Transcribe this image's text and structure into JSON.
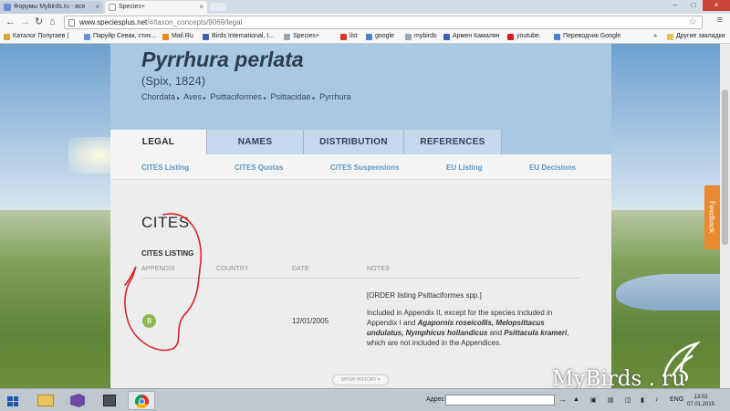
{
  "browser": {
    "tabs": [
      {
        "title": "Форумы Mybirds.ru - вся",
        "active": false
      },
      {
        "title": "Species+",
        "active": true
      }
    ],
    "url": {
      "host": "www.speciesplus.net",
      "path": "/#/taxon_concepts/9069/legal"
    },
    "bookmarks": [
      {
        "label": "Каталог Попугаев |",
        "color": "#d9a441"
      },
      {
        "label": "Паруйр Севак, стих...",
        "color": "#6a8ed6"
      },
      {
        "label": "Mail.Ru",
        "color": "#e98a1c"
      },
      {
        "label": "Birds International, I...",
        "color": "#3b64b0"
      },
      {
        "label": "Species+",
        "color": "#9aa5b1"
      },
      {
        "label": "list",
        "color": "#d23b2b"
      },
      {
        "label": "google",
        "color": "#4a7fd6"
      },
      {
        "label": "mybirds",
        "color": "#9aa5b1"
      },
      {
        "label": "Армен Камалян",
        "color": "#3b64b0"
      },
      {
        "label": "youtube.",
        "color": "#d21e1e"
      },
      {
        "label": "Переводчик Google",
        "color": "#4a7fd6"
      }
    ],
    "bookmarks_overflow": "»",
    "other_bookmarks": "Другие закладки"
  },
  "page": {
    "species_name": "Pyrrhura perlata",
    "author": "(Spix, 1824)",
    "taxonomy": [
      "Chordata",
      "Aves",
      "Psittaciformes",
      "Psittacidae",
      "Pyrrhura"
    ],
    "tabs": [
      {
        "label": "LEGAL",
        "active": true
      },
      {
        "label": "NAMES",
        "active": false
      },
      {
        "label": "DISTRIBUTION",
        "active": false
      },
      {
        "label": "REFERENCES",
        "active": false
      }
    ],
    "subtabs": [
      "CITES Listing",
      "CITES Quotas",
      "CITES Suspensions",
      "EU Listing",
      "EU Decisions"
    ],
    "section_title": "CITES",
    "listing_title": "CITES LISTING",
    "columns": [
      "APPENDIX",
      "COUNTRY",
      "DATE",
      "NOTES"
    ],
    "row": {
      "appendix": "II",
      "country": "",
      "date": "12/01/2005",
      "notes_order": "[ORDER listing Psittaciformes spp.]",
      "notes_part1": "Included in Appendix II, except for the species included in Appendix I and ",
      "notes_species1": "Agapornis roseicollis, Melopsittacus undulatus, Nymphicus hollandicus",
      "notes_and": " and ",
      "notes_species2": "Psittacula krameri",
      "notes_part2": ", which are not included in the Appendices."
    },
    "show_history": "SHOW HISTORY"
  },
  "feedback_label": "Feedback",
  "watermark": "MyBirds . ru",
  "taskbar": {
    "address_label": "Адрес",
    "language": "ENG",
    "time": "13:03",
    "date": "07.01.2015"
  },
  "colors": {
    "hero": "#a9c8e2",
    "tab_inactive": "#c4daec",
    "subtab_link": "#5a95c4",
    "appendix_badge": "#8db84f",
    "feedback": "#e8892f",
    "annotation": "#d6242a"
  },
  "icons": [
    "back-icon",
    "forward-icon",
    "reload-icon",
    "home-icon",
    "star-icon",
    "menu-icon",
    "folder-icon",
    "start-icon",
    "explorer-icon",
    "chrome-icon"
  ]
}
